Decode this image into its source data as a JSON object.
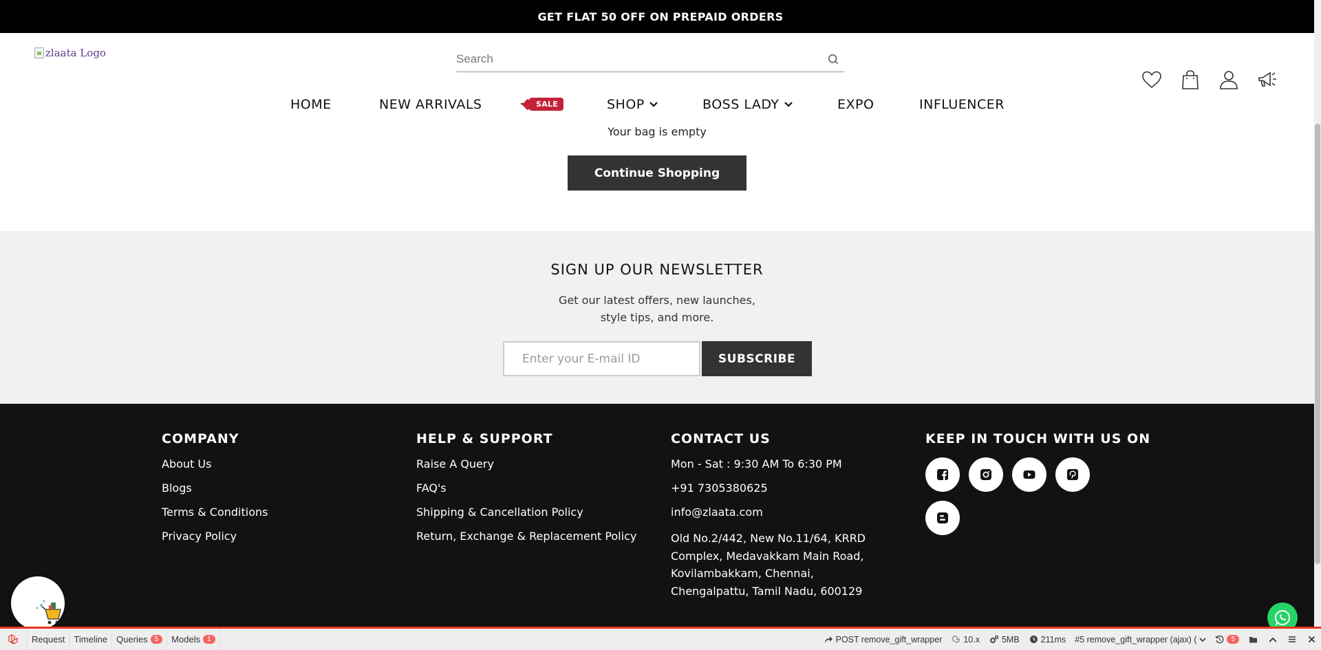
{
  "announcement": "GET FLAT 50 OFF ON PREPAID ORDERS",
  "header": {
    "logo_alt": "zlaata Logo",
    "search_placeholder": "Search",
    "nav": [
      {
        "label": "HOME"
      },
      {
        "label": "NEW ARRIVALS"
      },
      {
        "label": "SALE"
      },
      {
        "label": "SHOP"
      },
      {
        "label": "BOSS LADY"
      },
      {
        "label": "EXPO"
      },
      {
        "label": "INFLUENCER"
      }
    ],
    "icons": [
      "heart-icon",
      "bag-icon",
      "user-icon",
      "megaphone-icon"
    ]
  },
  "cart": {
    "empty_text": "Your bag is empty",
    "continue_label": "Continue Shopping"
  },
  "newsletter": {
    "title": "SIGN UP OUR NEWSLETTER",
    "subtitle_line1": "Get our latest offers, new launches,",
    "subtitle_line2": "style tips, and more.",
    "email_placeholder": "Enter your E-mail ID",
    "subscribe_label": "SUBSCRIBE"
  },
  "footer": {
    "company": {
      "title": "COMPANY",
      "links": [
        "About Us",
        "Blogs",
        "Terms & Conditions",
        "Privacy Policy"
      ]
    },
    "help": {
      "title": "HELP & SUPPORT",
      "links": [
        "Raise A Query",
        "FAQ's",
        "Shipping & Cancellation Policy",
        "Return, Exchange & Replacement Policy"
      ]
    },
    "contact": {
      "title": "CONTACT US",
      "hours": "Mon - Sat : 9:30 AM To 6:30 PM",
      "phone": "+91 7305380625",
      "email": "info@zlaata.com",
      "address": "Old No.2/442, New No.11/64, KRRD Complex, Medavakkam Main Road, Kovilambakkam, Chennai, Chengalpattu, Tamil Nadu, 600129"
    },
    "social": {
      "title": "KEEP IN TOUCH WITH US ON",
      "icons": [
        "facebook-icon",
        "instagram-icon",
        "youtube-icon",
        "pinterest-icon",
        "blogger-icon"
      ]
    }
  },
  "debugbar": {
    "tabs": [
      {
        "label": "Request"
      },
      {
        "label": "Timeline"
      },
      {
        "label": "Queries",
        "badge": "5"
      },
      {
        "label": "Models",
        "badge": "1"
      }
    ],
    "request": "POST remove_gift_wrapper",
    "version": "10.x",
    "memory": "5MB",
    "time": "211ms",
    "selected_request": "#5 remove_gift_wrapper (ajax) (",
    "history_badge": "5"
  },
  "colors": {
    "announcement_bg": "#000000",
    "sale_tag": "#c52238",
    "button_dark": "#333333",
    "footer_bg": "#121212",
    "newsletter_bg": "#f1f1f1",
    "debugbar_accent": "#e5341e",
    "whatsapp": "#25d366"
  }
}
